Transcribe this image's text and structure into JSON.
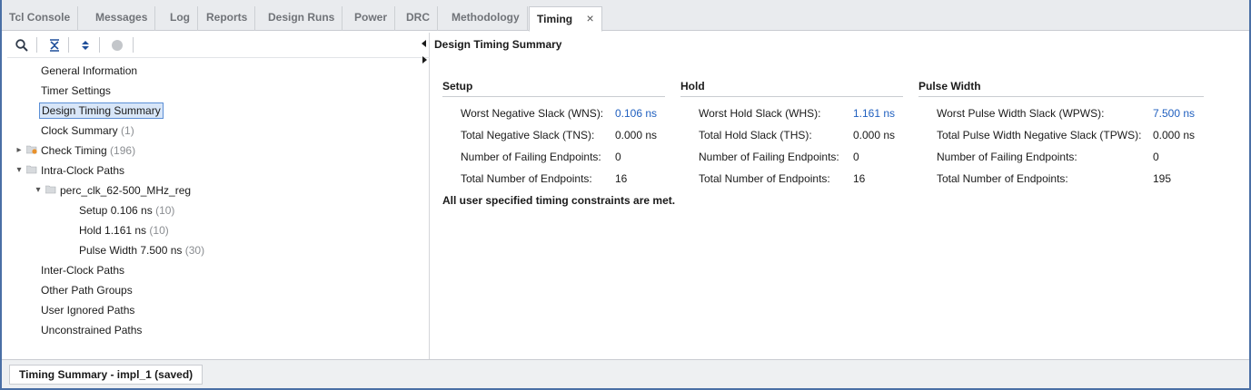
{
  "tabs": [
    {
      "label": "Tcl Console"
    },
    {
      "label": "Messages"
    },
    {
      "label": "Log"
    },
    {
      "label": "Reports"
    },
    {
      "label": "Design Runs"
    },
    {
      "label": "Power"
    },
    {
      "label": "DRC"
    },
    {
      "label": "Methodology"
    },
    {
      "label": "Timing",
      "active": true
    }
  ],
  "close_glyph": "×",
  "tree": {
    "general_information": "General Information",
    "timer_settings": "Timer Settings",
    "design_timing_summary": "Design Timing Summary",
    "clock_summary": {
      "label": "Clock Summary",
      "count": "(1)"
    },
    "check_timing": {
      "label": "Check Timing",
      "count": "(196)"
    },
    "intra_clock_paths": "Intra-Clock Paths",
    "clock_reg": "perc_clk_62-500_MHz_reg",
    "setup": {
      "label": "Setup 0.106 ns",
      "count": "(10)"
    },
    "hold": {
      "label": "Hold 1.161 ns",
      "count": "(10)"
    },
    "pulse_width": {
      "label": "Pulse Width 7.500 ns",
      "count": "(30)"
    },
    "inter_clock_paths": "Inter-Clock Paths",
    "other_path_groups": "Other Path Groups",
    "user_ignored_paths": "User Ignored Paths",
    "unconstrained_paths": "Unconstrained Paths"
  },
  "summary": {
    "title": "Design Timing Summary",
    "setup": {
      "heading": "Setup",
      "rows": [
        {
          "k": "Worst Negative Slack (WNS):",
          "v": "0.106 ns",
          "link": true
        },
        {
          "k": "Total Negative Slack (TNS):",
          "v": "0.000 ns"
        },
        {
          "k": "Number of Failing Endpoints:",
          "v": "0"
        },
        {
          "k": "Total Number of Endpoints:",
          "v": "16"
        }
      ]
    },
    "hold": {
      "heading": "Hold",
      "rows": [
        {
          "k": "Worst Hold Slack (WHS):",
          "v": "1.161 ns",
          "link": true
        },
        {
          "k": "Total Hold Slack (THS):",
          "v": "0.000 ns"
        },
        {
          "k": "Number of Failing Endpoints:",
          "v": "0"
        },
        {
          "k": "Total Number of Endpoints:",
          "v": "16"
        }
      ]
    },
    "pulse": {
      "heading": "Pulse Width",
      "rows": [
        {
          "k": "Worst Pulse Width Slack (WPWS):",
          "v": "7.500 ns",
          "link": true
        },
        {
          "k": "Total Pulse Width Negative Slack (TPWS):",
          "v": "0.000 ns"
        },
        {
          "k": "Number of Failing Endpoints:",
          "v": "0"
        },
        {
          "k": "Total Number of Endpoints:",
          "v": "195"
        }
      ]
    },
    "met_message": "All user specified timing constraints are met."
  },
  "status_tab": "Timing Summary - impl_1 (saved)",
  "icons": {
    "search": "search-icon",
    "collapse_all": "collapse-all-icon",
    "expand_all": "expand-all-icon",
    "stop": "stop-icon"
  },
  "colors": {
    "accent": "#1f5fbf",
    "frame": "#4a6fa5",
    "selected_bg": "#d8e6f8"
  }
}
